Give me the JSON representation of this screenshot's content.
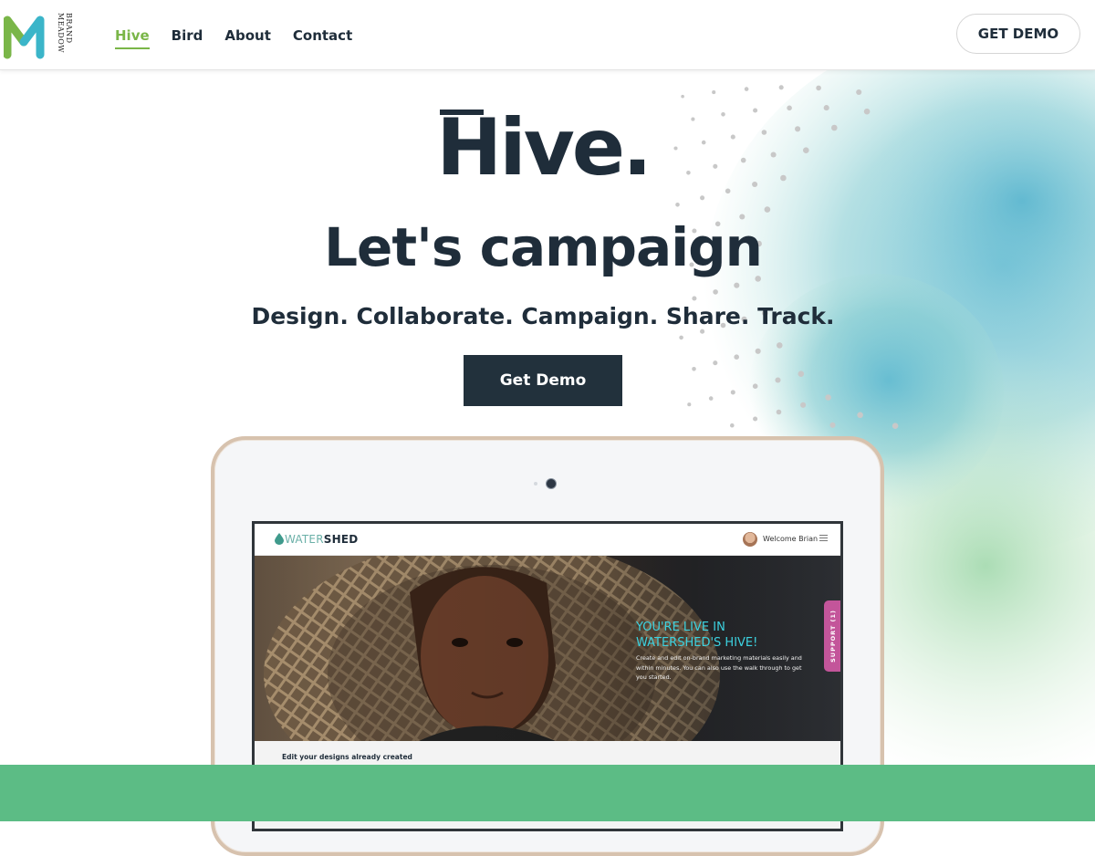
{
  "header": {
    "logo": {
      "letter": "M",
      "words": [
        "BRAND",
        "MEADOW"
      ]
    },
    "nav": [
      {
        "label": "Hive",
        "active": true
      },
      {
        "label": "Bird",
        "active": false
      },
      {
        "label": "About",
        "active": false
      },
      {
        "label": "Contact",
        "active": false
      }
    ],
    "demo_button": "GET DEMO"
  },
  "hero": {
    "title": "Hive.",
    "subtitle": "Let's campaign",
    "tagline": "Design. Collaborate. Campaign. Share. Track.",
    "cta": "Get Demo"
  },
  "tablet": {
    "app": {
      "logo_light": "WATER",
      "logo_bold": "SHED",
      "welcome": "Welcome Brian",
      "banner_title_line1": "YOU'RE LIVE IN",
      "banner_title_line2": "WATERSHED'S HIVE!",
      "banner_body": "Create and edit on-brand marketing materials easily and within minutes. You can also use the walk through to get you started.",
      "support_tab": "SUPPORT (1)",
      "section_label": "Edit your designs already created"
    }
  },
  "colors": {
    "accent_green": "#7ab648",
    "dark_navy": "#1f2d3a",
    "button_dark": "#22313c",
    "band_green": "#5cbc85",
    "watercolor_blue": "#62bfd0",
    "watercolor_green": "#9fd6a6",
    "live_title_cyan": "#3cd2e0",
    "support_pink": "#c3559a"
  }
}
